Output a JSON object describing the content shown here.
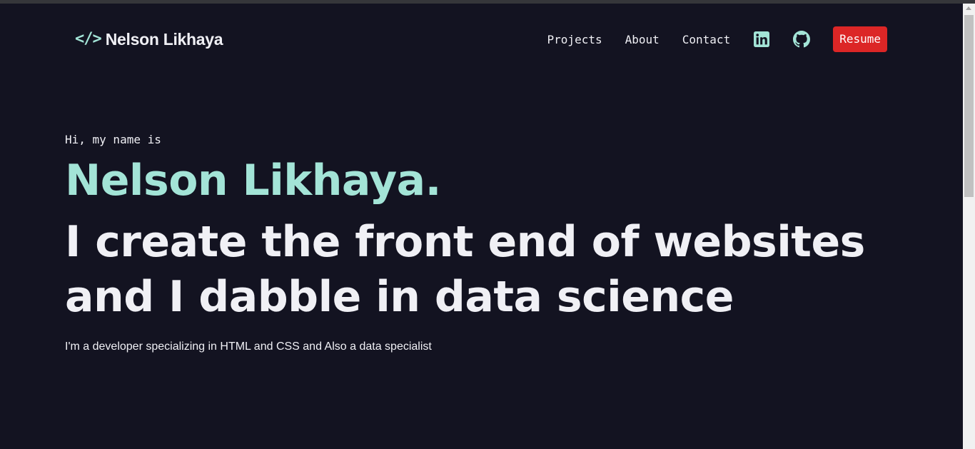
{
  "navbar": {
    "logo_glyph": "</>",
    "brand_name": "Nelson Likhaya",
    "links": [
      {
        "label": "Projects"
      },
      {
        "label": "About"
      },
      {
        "label": "Contact"
      }
    ],
    "icons": [
      {
        "name": "linkedin-icon",
        "color": "#a3e4d7"
      },
      {
        "name": "github-icon",
        "color": "#a3e4d7"
      }
    ],
    "resume_label": "Resume",
    "resume_color": "#dc2626"
  },
  "hero": {
    "greeting": "Hi, my name is",
    "name": "Nelson Likhaya.",
    "tagline": "I create the front end of websites and I dabble in data science",
    "description": "I'm a developer specializing in HTML and CSS and Also a data specialist"
  },
  "colors": {
    "background": "#131321",
    "accent": "#a3e4d7",
    "text": "#f0f0f5",
    "button": "#dc2626"
  }
}
